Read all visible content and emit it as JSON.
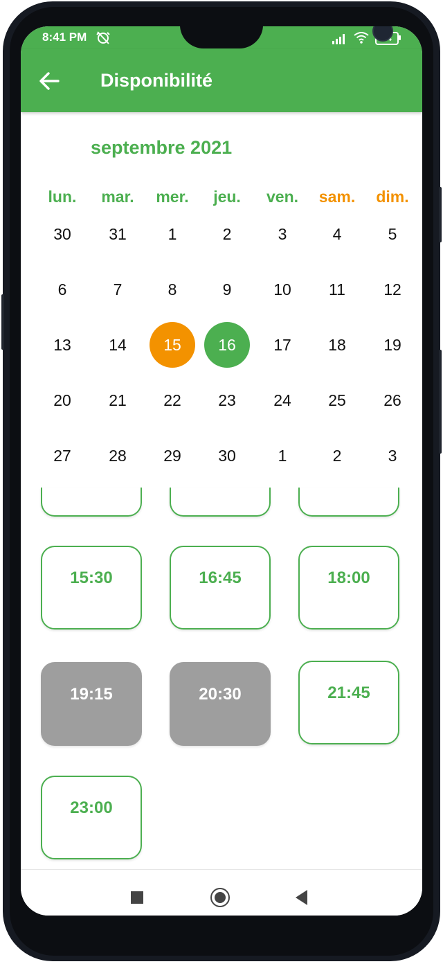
{
  "status_bar": {
    "time": "8:41 PM",
    "battery": "24"
  },
  "app_bar": {
    "title": "Disponibilité"
  },
  "calendar": {
    "month_label": "septembre 2021",
    "weekdays": [
      "lun.",
      "mar.",
      "mer.",
      "jeu.",
      "ven.",
      "sam.",
      "dim."
    ],
    "weeks": [
      [
        "30",
        "31",
        "1",
        "2",
        "3",
        "4",
        "5"
      ],
      [
        "6",
        "7",
        "8",
        "9",
        "10",
        "11",
        "12"
      ],
      [
        "13",
        "14",
        "15",
        "16",
        "17",
        "18",
        "19"
      ],
      [
        "20",
        "21",
        "22",
        "23",
        "24",
        "25",
        "26"
      ],
      [
        "27",
        "28",
        "29",
        "30",
        "1",
        "2",
        "3"
      ]
    ],
    "today": "15",
    "selected": "16"
  },
  "time_slots": [
    {
      "time": "15:30",
      "available": true
    },
    {
      "time": "16:45",
      "available": true
    },
    {
      "time": "18:00",
      "available": true
    },
    {
      "time": "19:15",
      "available": false
    },
    {
      "time": "20:30",
      "available": false
    },
    {
      "time": "21:45",
      "available": true
    },
    {
      "time": "23:00",
      "available": true
    }
  ],
  "colors": {
    "primary": "#4caf50",
    "weekend": "#f39200",
    "today": "#f39200",
    "disabled": "#9e9e9e"
  }
}
